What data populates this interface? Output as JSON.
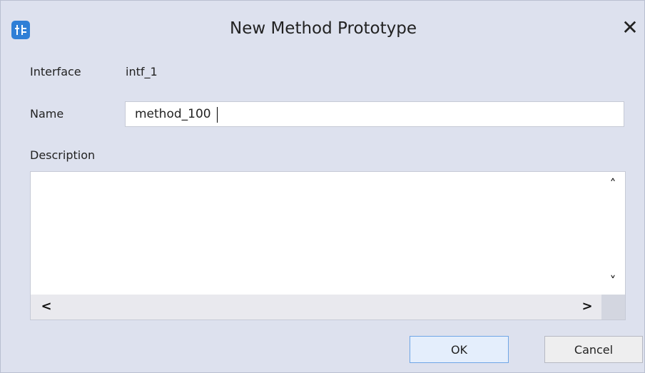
{
  "window": {
    "title": "New Method Prototype",
    "icon": "interface-app-icon",
    "close_icon": "close-icon"
  },
  "form": {
    "interface_label": "Interface",
    "interface_value": "intf_1",
    "name_label": "Name",
    "name_value": "method_100",
    "description_label": "Description",
    "description_value": ""
  },
  "scrollbars": {
    "up": "˄",
    "down": "˅",
    "left": "<",
    "right": ">"
  },
  "buttons": {
    "ok": "OK",
    "cancel": "Cancel"
  },
  "colors": {
    "dialog_background": "#dde1ee",
    "app_icon": "#2f7fd6",
    "ok_border": "#6fa6e6",
    "ok_background": "#e4eefc"
  }
}
